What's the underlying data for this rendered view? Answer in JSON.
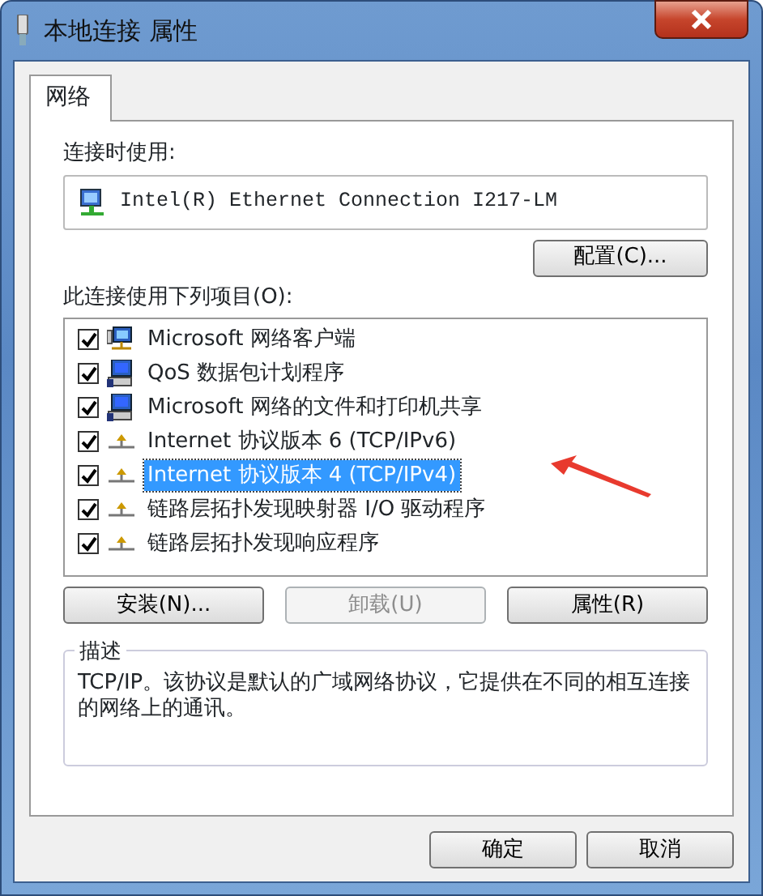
{
  "window": {
    "title": "本地连接 属性"
  },
  "tabs": [
    {
      "label": "网络",
      "selected": true
    }
  ],
  "connect_using": {
    "label": "连接时使用:",
    "adapter": "Intel(R) Ethernet Connection I217-LM",
    "configure_button": "配置(C)..."
  },
  "items_label": "此连接使用下列项目(O):",
  "items": [
    {
      "kind": "client",
      "label": "Microsoft 网络客户端",
      "checked": true,
      "selected": false
    },
    {
      "kind": "service",
      "label": "QoS 数据包计划程序",
      "checked": true,
      "selected": false
    },
    {
      "kind": "service",
      "label": "Microsoft 网络的文件和打印机共享",
      "checked": true,
      "selected": false
    },
    {
      "kind": "protocol",
      "label": "Internet 协议版本 6 (TCP/IPv6)",
      "checked": true,
      "selected": false
    },
    {
      "kind": "protocol",
      "label": "Internet 协议版本 4 (TCP/IPv4)",
      "checked": true,
      "selected": true
    },
    {
      "kind": "protocol",
      "label": "链路层拓扑发现映射器 I/O 驱动程序",
      "checked": true,
      "selected": false
    },
    {
      "kind": "protocol",
      "label": "链路层拓扑发现响应程序",
      "checked": true,
      "selected": false
    }
  ],
  "item_buttons": [
    {
      "label": "安装(N)...",
      "disabled": false
    },
    {
      "label": "卸载(U)",
      "disabled": true
    },
    {
      "label": "属性(R)",
      "disabled": false
    }
  ],
  "description": {
    "title": "描述",
    "text": "TCP/IP。该协议是默认的广域网络协议，它提供在不同的相互连接的网络上的通讯。"
  },
  "dialog_buttons": [
    "确定",
    "取消"
  ]
}
